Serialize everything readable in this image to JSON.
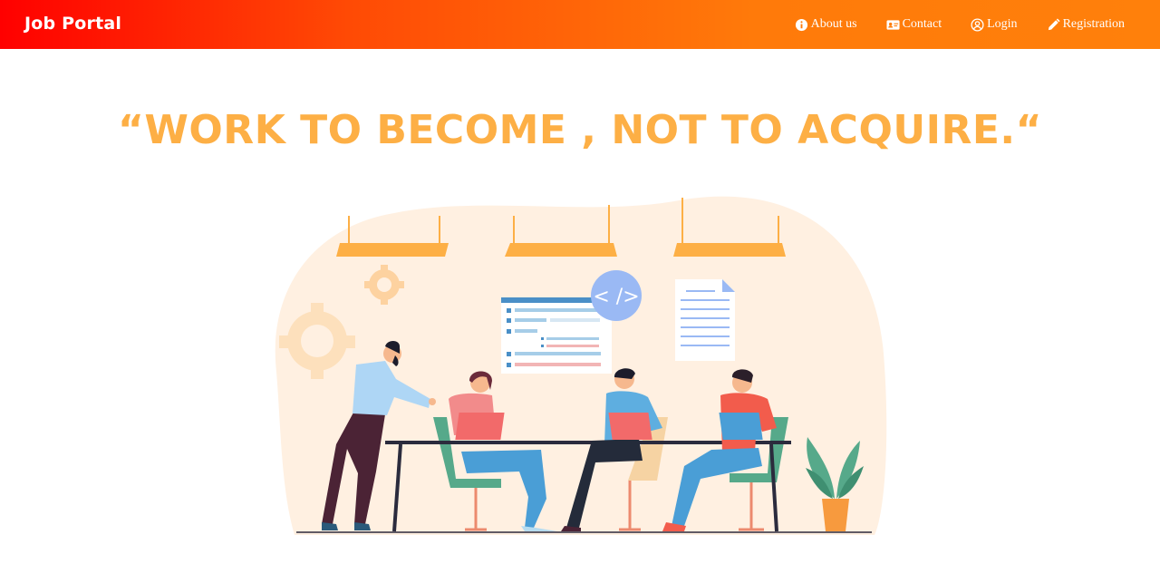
{
  "navbar": {
    "brand": "Job Portal",
    "links": [
      {
        "label": "About us",
        "icon": "info-icon"
      },
      {
        "label": "Contact",
        "icon": "contact-card-icon"
      },
      {
        "label": "Login",
        "icon": "user-circle-icon"
      },
      {
        "label": "Registration",
        "icon": "pencil-icon"
      }
    ]
  },
  "hero": {
    "quote": "“WORK TO BECOME , NOT TO ACQUIRE.“",
    "illustration_code_badge": "< />"
  },
  "colors": {
    "nav_gradient_start": "#ff0000",
    "nav_gradient_end": "#ff800b",
    "quote": "#fdaf45",
    "blob": "#fff0e1"
  }
}
